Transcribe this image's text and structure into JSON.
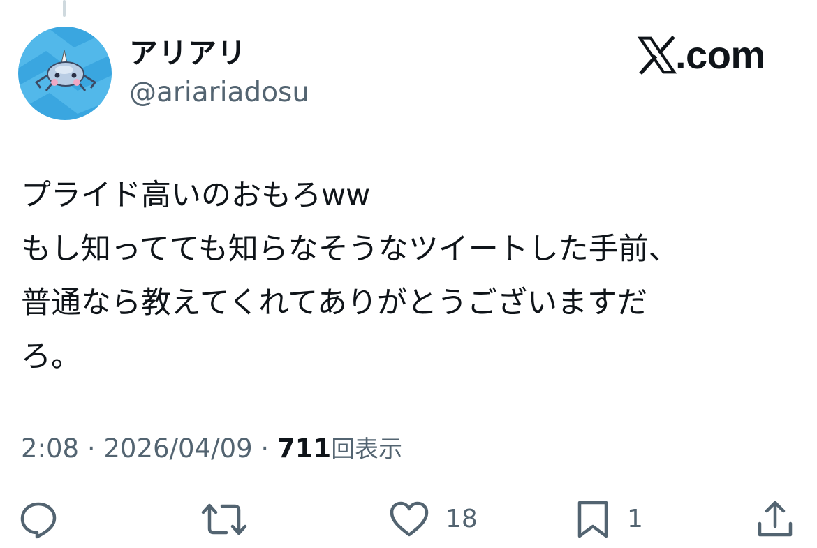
{
  "post": {
    "author": {
      "display_name": "アリアリ",
      "handle": "@ariariadosu",
      "avatar": "spider-pokemon-avatar"
    },
    "brand": {
      "text": ".com",
      "icon": "x-logo-icon"
    },
    "text_lines": [
      "プライド高いのおもろww",
      "もし知ってても知らなそうなツイートした手前、",
      "普通なら教えてくれてありがとうございますだ",
      "ろ。"
    ],
    "time": "2:08",
    "separator": "·",
    "date": "2026/04/09",
    "views_count": "711",
    "views_label": "回表示"
  },
  "actions": {
    "reply": {
      "icon": "reply-icon"
    },
    "repost": {
      "icon": "repost-icon"
    },
    "like": {
      "icon": "heart-icon",
      "count": "18"
    },
    "bookmark": {
      "icon": "bookmark-icon",
      "count": "1"
    },
    "share": {
      "icon": "share-icon"
    }
  },
  "colors": {
    "text": "#0f1419",
    "secondary": "#536471",
    "avatar_background": "#3aa6e0"
  }
}
